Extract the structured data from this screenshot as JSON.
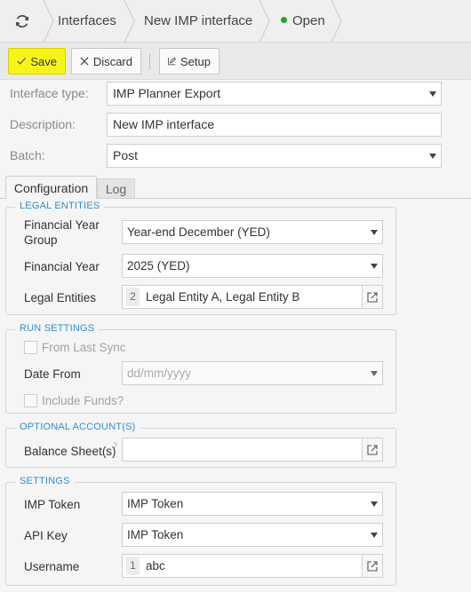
{
  "breadcrumb": {
    "items": [
      "Interfaces",
      "New IMP interface"
    ],
    "status": "Open",
    "status_color": "#2aa02a"
  },
  "toolbar": {
    "save_label": "Save",
    "discard_label": "Discard",
    "setup_label": "Setup",
    "save_color": "#f7f41c"
  },
  "form": {
    "interface_type_label": "Interface type:",
    "interface_type_value": "IMP Planner Export",
    "description_label": "Description:",
    "description_value": "New IMP interface",
    "batch_label": "Batch:",
    "batch_value": "Post"
  },
  "tabs": [
    "Configuration",
    "Log"
  ],
  "legal_entities": {
    "title": "LEGAL ENTITIES",
    "fy_group_label": "Financial Year Group",
    "fy_group_value": "Year-end December (YED)",
    "fy_label": "Financial Year",
    "fy_value": "2025 (YED)",
    "le_label": "Legal Entities",
    "le_count": "2",
    "le_value": "Legal Entity A, Legal Entity B"
  },
  "run_settings": {
    "title": "RUN SETTINGS",
    "from_last_sync_label": "From Last Sync",
    "date_from_label": "Date From",
    "date_from_placeholder": "dd/mm/yyyy",
    "include_funds_label": "Include Funds?"
  },
  "optional_accounts": {
    "title": "OPTIONAL ACCOUNT(S)",
    "balance_sheet_label": "Balance Sheet(s)",
    "help_mark": "?"
  },
  "settings": {
    "title": "SETTINGS",
    "imp_token_label": "IMP Token",
    "imp_token_value": "IMP Token",
    "api_key_label": "API Key",
    "api_key_value": "IMP Token",
    "username_label": "Username",
    "username_count": "1",
    "username_value": "abc"
  },
  "accent_color": "#2f8fce"
}
